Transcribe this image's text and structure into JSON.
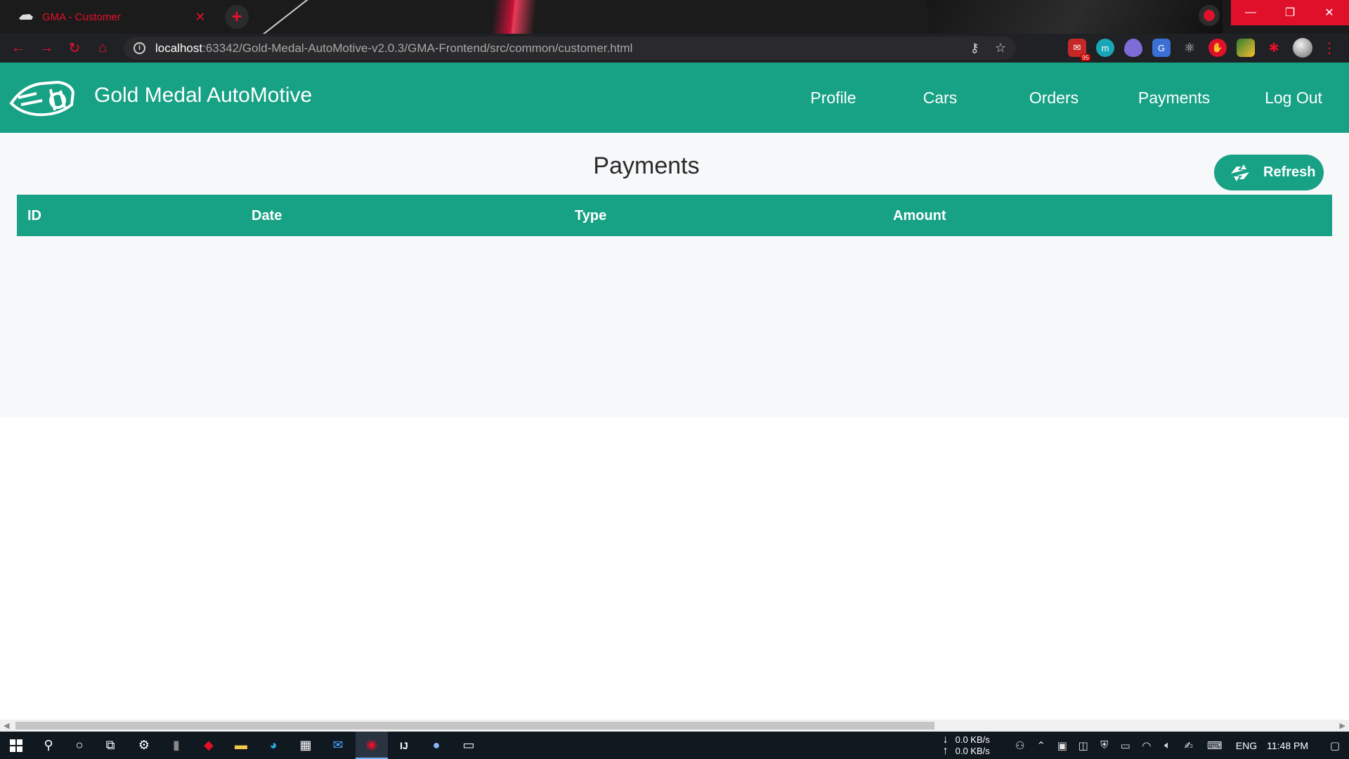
{
  "browser": {
    "tab_title": "GMA - Customer",
    "tab_close": "✕",
    "new_tab": "+",
    "url_host": "localhost",
    "url_path": ":63342/Gold-Medal-AutoMotive-v2.0.3/GMA-Frontend/src/common/customer.html",
    "window_buttons": {
      "minimize": "—",
      "restore": "❐",
      "close": "✕"
    },
    "extension_badge": "95"
  },
  "navbar": {
    "brand": "Gold Medal AutoMotive",
    "links": [
      "Profile",
      "Cars",
      "Orders",
      "Payments",
      "Log Out"
    ]
  },
  "main": {
    "title": "Payments",
    "refresh_label": "Refresh",
    "table_headers": [
      "ID",
      "Date",
      "Type",
      "Amount"
    ],
    "rows": []
  },
  "taskbar": {
    "net_down": "0.0 KB/s",
    "net_up": "0.0 KB/s",
    "language": "ENG",
    "time": "11:48 PM"
  },
  "colors": {
    "brand_teal": "#17a185",
    "browser_accent": "#e8102c",
    "content_bg": "#f7f8fa"
  }
}
